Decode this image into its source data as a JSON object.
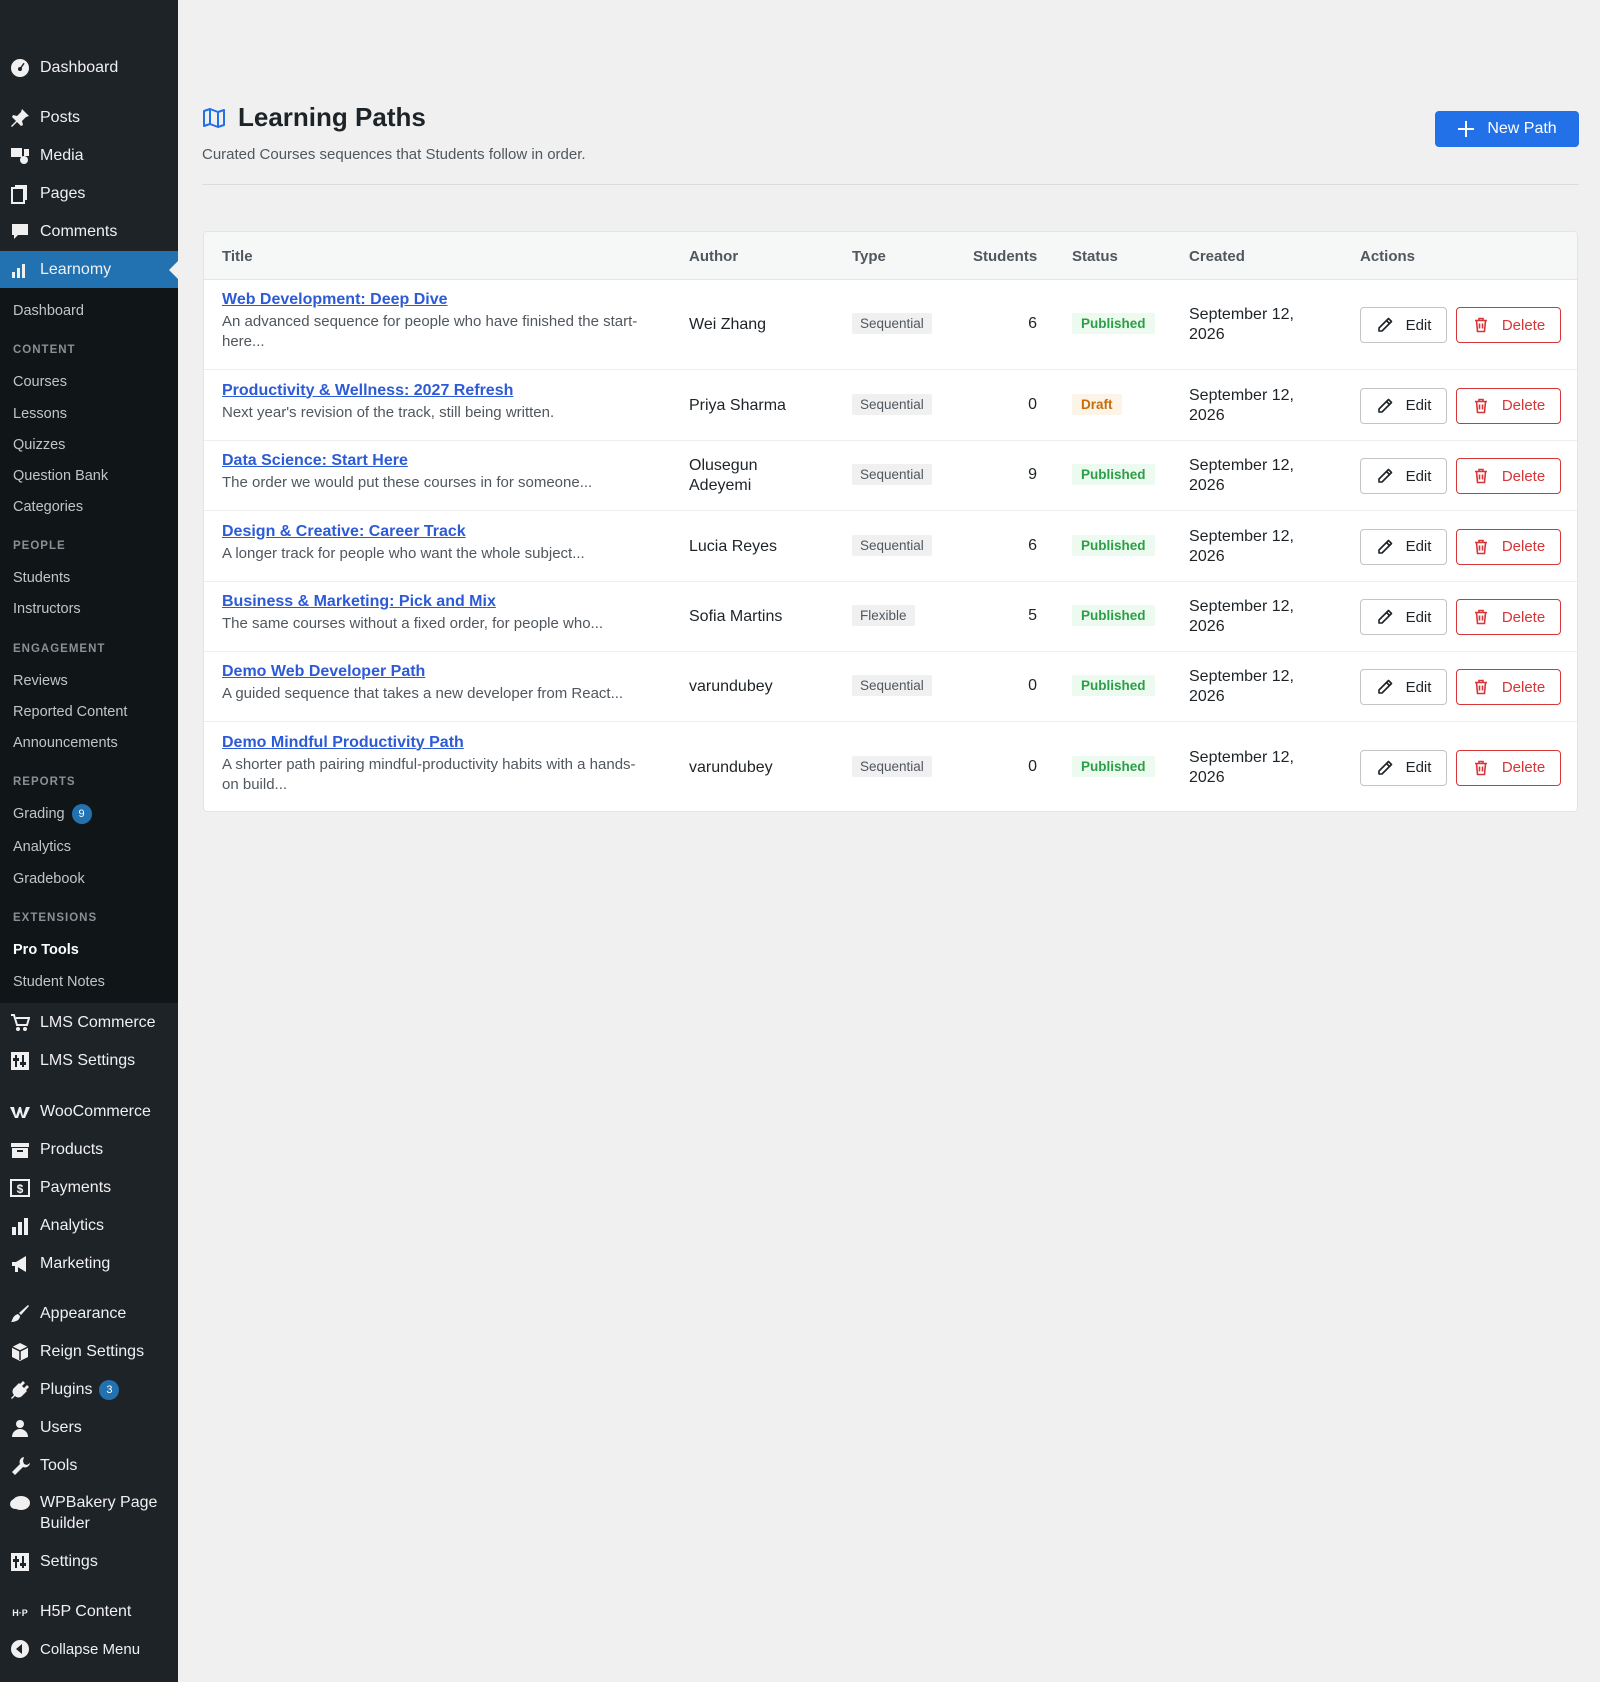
{
  "sidebar": {
    "top": [
      {
        "label": "Dashboard",
        "icon": "dashboard-icon"
      },
      {
        "label": "Posts",
        "icon": "pushpin-icon"
      },
      {
        "label": "Media",
        "icon": "media-icon"
      },
      {
        "label": "Pages",
        "icon": "pages-icon"
      },
      {
        "label": "Comments",
        "icon": "comment-icon"
      },
      {
        "label": "Learnomy",
        "icon": "bar-chart-icon"
      }
    ],
    "sub": {
      "dashboard": "Dashboard",
      "content_heading": "CONTENT",
      "courses": "Courses",
      "lessons": "Lessons",
      "quizzes": "Quizzes",
      "question_bank": "Question Bank",
      "categories": "Categories",
      "people_heading": "PEOPLE",
      "students": "Students",
      "instructors": "Instructors",
      "engagement_heading": "ENGAGEMENT",
      "reviews": "Reviews",
      "reported_content": "Reported Content",
      "announcements": "Announcements",
      "reports_heading": "REPORTS",
      "grading": "Grading",
      "grading_badge": "9",
      "analytics": "Analytics",
      "gradebook": "Gradebook",
      "extensions_heading": "EXTENSIONS",
      "pro_tools": "Pro Tools",
      "student_notes": "Student Notes"
    },
    "bottom": {
      "lms_commerce": "LMS Commerce",
      "lms_settings": "LMS Settings",
      "woocommerce": "WooCommerce",
      "products": "Products",
      "payments": "Payments",
      "analytics": "Analytics",
      "marketing": "Marketing",
      "appearance": "Appearance",
      "reign_settings": "Reign Settings",
      "plugins": "Plugins",
      "plugins_badge": "3",
      "users": "Users",
      "tools": "Tools",
      "wpbakery_line1": "WPBakery Page",
      "wpbakery_line2": "Builder",
      "settings": "Settings",
      "h5p": "H5P Content",
      "collapse": "Collapse Menu"
    }
  },
  "header": {
    "title": "Learning Paths",
    "subtitle": "Curated Courses sequences that Students follow in order.",
    "new_button": "New Path"
  },
  "table": {
    "columns": [
      "Title",
      "Author",
      "Type",
      "Students",
      "Status",
      "Created",
      "Actions"
    ],
    "edit_label": "Edit",
    "delete_label": "Delete",
    "rows": [
      {
        "title": "Web Development: Deep Dive",
        "desc": "An advanced sequence for people who have finished the start-here...",
        "author": "Wei Zhang",
        "type": "Sequential",
        "students": "6",
        "status": "Published",
        "created_line1": "September 12,",
        "created_line2": "2026"
      },
      {
        "title": "Productivity & Wellness: 2027 Refresh",
        "desc": "Next year's revision of the track, still being written.",
        "author": "Priya Sharma",
        "type": "Sequential",
        "students": "0",
        "status": "Draft",
        "created_line1": "September 12,",
        "created_line2": "2026"
      },
      {
        "title": "Data Science: Start Here",
        "desc": "The order we would put these courses in for someone...",
        "author": "Olusegun Adeyemi",
        "type": "Sequential",
        "students": "9",
        "status": "Published",
        "created_line1": "September 12,",
        "created_line2": "2026"
      },
      {
        "title": "Design & Creative: Career Track",
        "desc": "A longer track for people who want the whole subject...",
        "author": "Lucia Reyes",
        "type": "Sequential",
        "students": "6",
        "status": "Published",
        "created_line1": "September 12,",
        "created_line2": "2026"
      },
      {
        "title": "Business & Marketing: Pick and Mix",
        "desc": "The same courses without a fixed order, for people who...",
        "author": "Sofia Martins",
        "type": "Flexible",
        "students": "5",
        "status": "Published",
        "created_line1": "September 12,",
        "created_line2": "2026"
      },
      {
        "title": "Demo Web Developer Path",
        "desc": "A guided sequence that takes a new developer from React...",
        "author": "varundubey",
        "type": "Sequential",
        "students": "0",
        "status": "Published",
        "created_line1": "September 12,",
        "created_line2": "2026"
      },
      {
        "title": "Demo Mindful Productivity Path",
        "desc": "A shorter path pairing mindful-productivity habits with a hands-on build...",
        "author": "varundubey",
        "type": "Sequential",
        "students": "0",
        "status": "Published",
        "created_line1": "September 12,",
        "created_line2": "2026"
      }
    ]
  },
  "colors": {
    "accent": "#2271e8",
    "sidebar_bg": "#1d2327",
    "published": "#2a9f47",
    "draft": "#c66d0b",
    "delete": "#d63638",
    "link": "#2d5bd7"
  }
}
